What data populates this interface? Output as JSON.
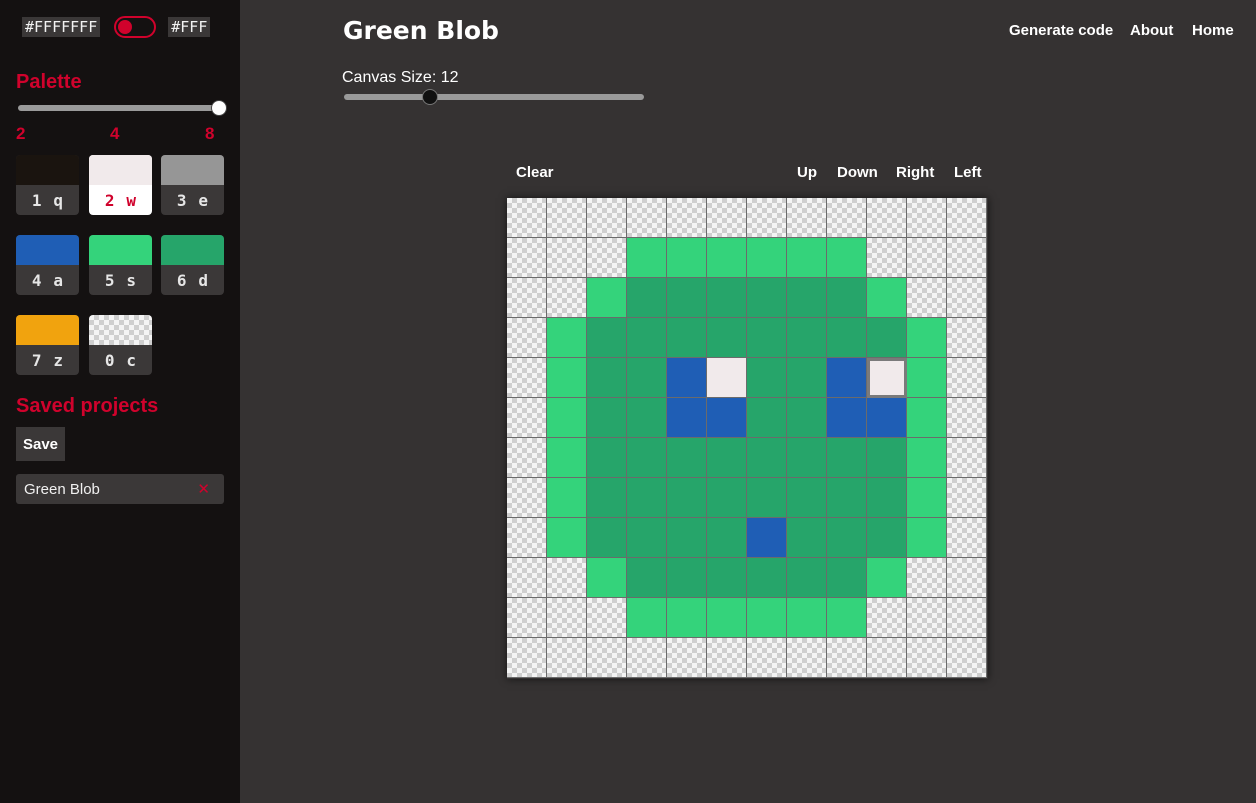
{
  "sidebar": {
    "mode": {
      "left_hex": "#FFFFFFF",
      "right_hex": "#FFF",
      "accent": "#d0022c"
    },
    "palette_title": "Palette",
    "palette_size": {
      "ticks": [
        "2",
        "4",
        "8"
      ],
      "value": 8,
      "min": 2,
      "max": 8
    },
    "swatches": [
      {
        "color": "#1a140f",
        "index": "1",
        "key": "q",
        "selected": false
      },
      {
        "color": "#f1eaeb",
        "index": "2",
        "key": "w",
        "selected": true
      },
      {
        "color": "#969696",
        "index": "3",
        "key": "e",
        "selected": false
      },
      {
        "color": "#1f5eb5",
        "index": "4",
        "key": "a",
        "selected": false
      },
      {
        "color": "#34d37b",
        "index": "5",
        "key": "s",
        "selected": false
      },
      {
        "color": "#26a56a",
        "index": "6",
        "key": "d",
        "selected": false
      },
      {
        "color": "#f1a30e",
        "index": "7",
        "key": "z",
        "selected": false
      },
      {
        "color": "transparent",
        "index": "0",
        "key": "c",
        "selected": false
      }
    ],
    "saved_title": "Saved projects",
    "save_label": "Save",
    "projects": [
      {
        "name": "Green Blob",
        "delete_glyph": "✕"
      }
    ]
  },
  "header": {
    "title": "Green Blob",
    "nav": [
      "Generate code",
      "About",
      "Home"
    ]
  },
  "canvas_size": {
    "label": "Canvas Size: 12",
    "value": 12,
    "min": 4,
    "max": 32
  },
  "toolbar": {
    "clear": "Clear",
    "up": "Up",
    "down": "Down",
    "right": "Right",
    "left": "Left"
  },
  "canvas": {
    "size": 12,
    "cursor": {
      "row": 4,
      "col": 9
    },
    "rows": [
      "000000000000",
      "000555555000",
      "005666666500",
      "056666666650",
      "056642664250",
      "056644664450",
      "056666666650",
      "056666666650",
      "056666466650",
      "005666666500",
      "000555555000",
      "000000000000"
    ]
  }
}
